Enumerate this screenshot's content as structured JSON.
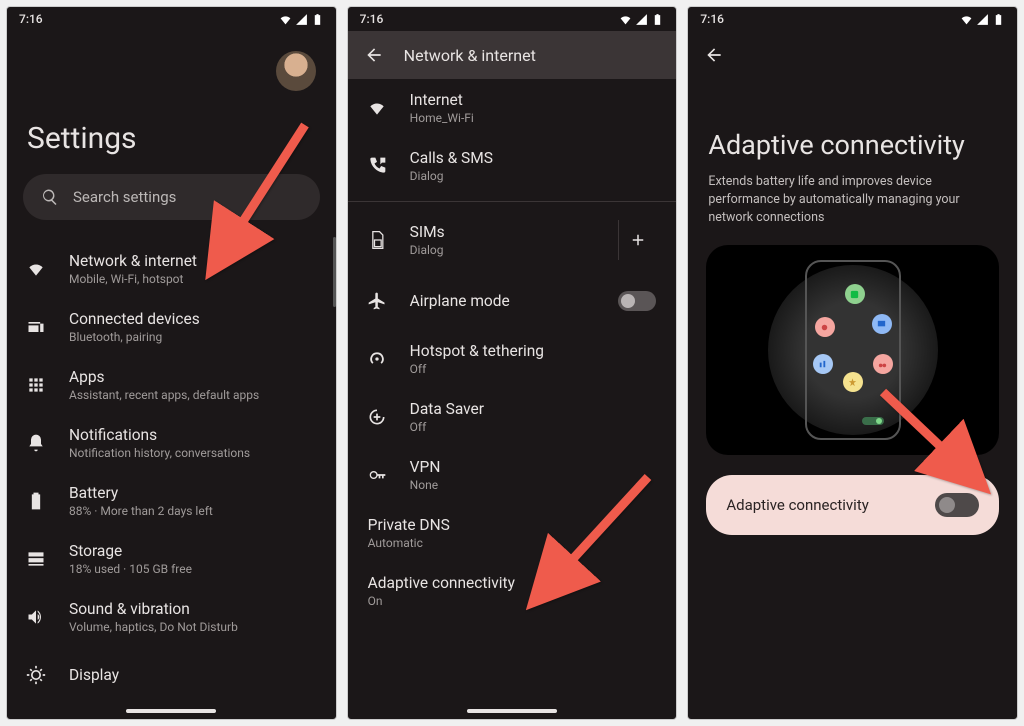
{
  "status": {
    "time": "7:16"
  },
  "screen1": {
    "title": "Settings",
    "search_placeholder": "Search settings",
    "items": [
      {
        "title": "Network & internet",
        "sub": "Mobile, Wi-Fi, hotspot"
      },
      {
        "title": "Connected devices",
        "sub": "Bluetooth, pairing"
      },
      {
        "title": "Apps",
        "sub": "Assistant, recent apps, default apps"
      },
      {
        "title": "Notifications",
        "sub": "Notification history, conversations"
      },
      {
        "title": "Battery",
        "sub": "88% · More than 2 days left"
      },
      {
        "title": "Storage",
        "sub": "18% used · 105 GB free"
      },
      {
        "title": "Sound & vibration",
        "sub": "Volume, haptics, Do Not Disturb"
      },
      {
        "title": "Display",
        "sub": ""
      }
    ]
  },
  "screen2": {
    "title": "Network & internet",
    "items": [
      {
        "title": "Internet",
        "sub": "Home_Wi-Fi"
      },
      {
        "title": "Calls & SMS",
        "sub": "Dialog"
      },
      {
        "title": "SIMs",
        "sub": "Dialog"
      },
      {
        "title": "Airplane mode",
        "sub": ""
      },
      {
        "title": "Hotspot & tethering",
        "sub": "Off"
      },
      {
        "title": "Data Saver",
        "sub": "Off"
      },
      {
        "title": "VPN",
        "sub": "None"
      },
      {
        "title": "Private DNS",
        "sub": "Automatic"
      },
      {
        "title": "Adaptive connectivity",
        "sub": "On"
      }
    ]
  },
  "screen3": {
    "title": "Adaptive connectivity",
    "desc": "Extends battery life and improves device performance by automatically managing your network connections",
    "toggle_label": "Adaptive connectivity"
  }
}
